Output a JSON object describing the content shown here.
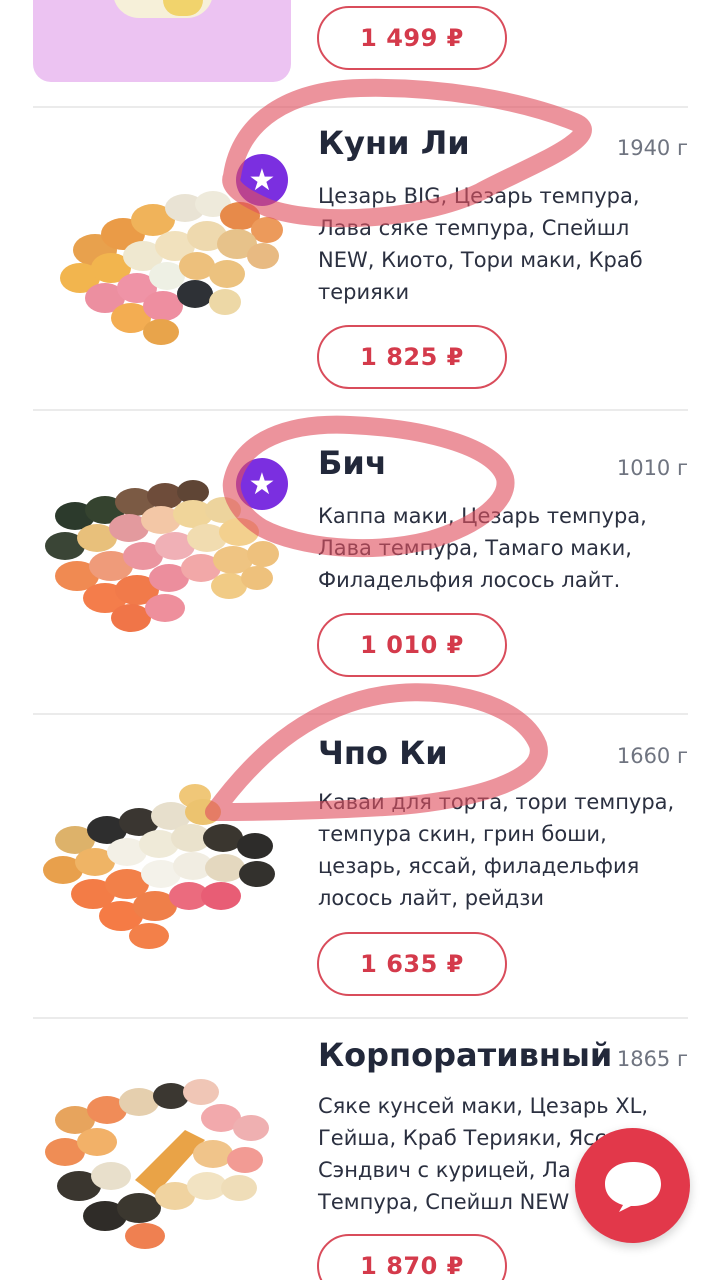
{
  "top_item": {
    "price": "1 499 ₽"
  },
  "items": [
    {
      "title": "Куни Ли",
      "weight": "1940 г",
      "description": "Цезарь BIG, Цезарь темпура, Лава сяке темпура, Спейшл NEW, Киото, Тори маки, Краб терияки",
      "price": "1 825 ₽",
      "badge_icon": "star-icon"
    },
    {
      "title": "Бич",
      "weight": "1010 г",
      "description": "Каппа маки, Цезарь темпура, Лава темпура, Тамаго маки, Филадельфия лосось лайт.",
      "price": "1 010 ₽",
      "badge_icon": "star-icon"
    },
    {
      "title": "Чпо Ки",
      "weight": "1660 г",
      "description": "Каваи для торта, тори темпура, темпура скин, грин боши, цезарь, яссай, филадельфия лосось лайт, рейдзи",
      "price": "1 635 ₽"
    },
    {
      "title": "Корпоративный",
      "weight": "1865 г",
      "description": "Сяке кунсей маки, Цезарь XL, Гейша, Краб Терияки, Ясс Сэндвич с курицей, Ла Темпура, Спейшл NEW",
      "price": "1 870 ₽"
    }
  ],
  "chat_button": {
    "icon": "chat-bubble-icon"
  },
  "colors": {
    "accent": "#d43a4b",
    "badge": "#7b2fe0",
    "scribble": "#e0505f"
  }
}
